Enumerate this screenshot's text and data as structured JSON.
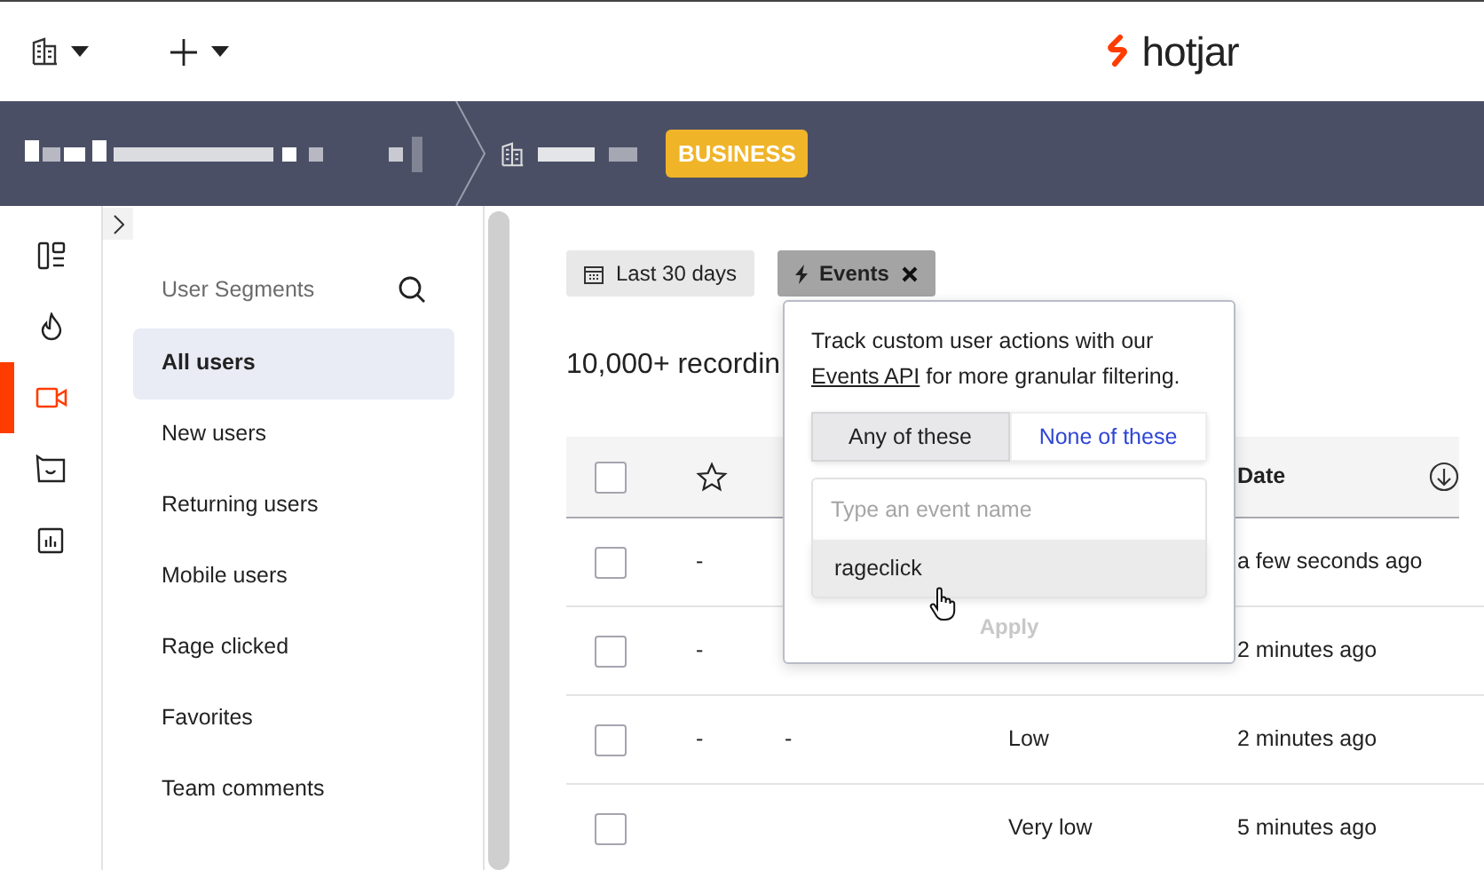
{
  "topbar": {
    "logo": "hotjar"
  },
  "breadcrumb": {
    "badge": "BUSINESS"
  },
  "rail": {
    "items": [
      {
        "kind": "dashboard",
        "selected": false
      },
      {
        "kind": "heatmaps",
        "selected": false
      },
      {
        "kind": "recordings",
        "selected": true
      },
      {
        "kind": "feedback",
        "selected": false
      },
      {
        "kind": "surveys",
        "selected": false
      }
    ]
  },
  "segments": {
    "title": "User Segments",
    "items": [
      {
        "label": "All users",
        "selected": true
      },
      {
        "label": "New users",
        "selected": false
      },
      {
        "label": "Returning users",
        "selected": false
      },
      {
        "label": "Mobile users",
        "selected": false
      },
      {
        "label": "Rage clicked",
        "selected": false
      },
      {
        "label": "Favorites",
        "selected": false
      },
      {
        "label": "Team comments",
        "selected": false
      }
    ]
  },
  "filters": [
    {
      "kind": "date",
      "label": "Last 30 days",
      "active": false
    },
    {
      "kind": "event",
      "label": "Events",
      "active": true
    }
  ],
  "results_count": "10,000+ recordin",
  "table": {
    "date_header": "Date",
    "header_checked": false,
    "rows": [
      {
        "checked": false,
        "column_2": "-",
        "date": "a few seconds ago"
      },
      {
        "checked": false,
        "column_2": "-",
        "date": "2 minutes ago"
      },
      {
        "checked": false,
        "column_2": "-",
        "column_3": "-",
        "column_4": "Low",
        "date": "2 minutes ago"
      },
      {
        "checked": false,
        "column_4": "Very low",
        "date": "5 minutes ago"
      }
    ]
  },
  "event_filter": {
    "description": [
      {
        "kind": "text",
        "text": "Track custom user actions with our"
      },
      {
        "kind": "link",
        "text": "Events API"
      },
      {
        "kind": "text",
        "text": "for more granular filtering."
      }
    ],
    "modes": [
      {
        "label": "Any of these",
        "selected": true
      },
      {
        "label": "None of these",
        "selected": false
      }
    ],
    "search": {
      "placeholder": "Type an event name"
    },
    "suggestions": [
      {
        "label": "rageclick",
        "highlighted": true
      }
    ],
    "apply": {
      "label": "Apply",
      "disabled": true
    }
  }
}
